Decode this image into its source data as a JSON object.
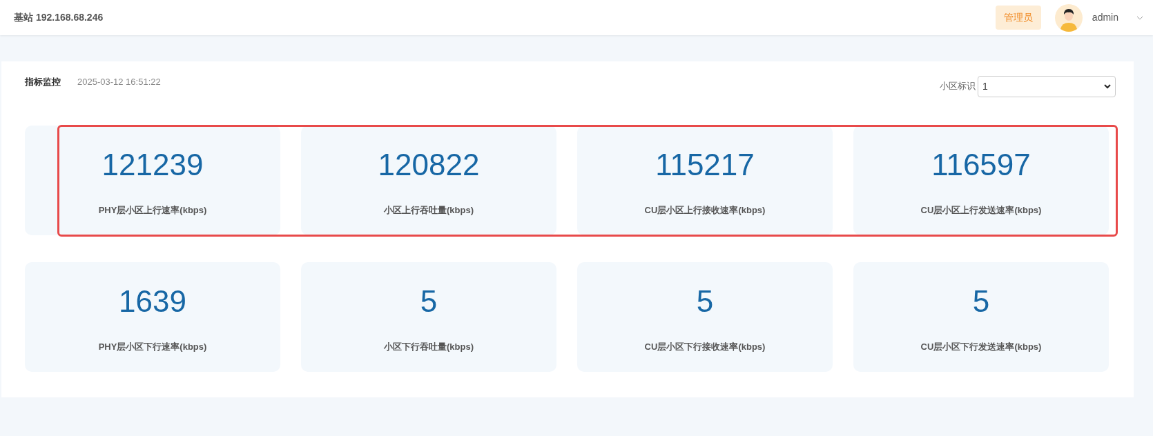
{
  "header": {
    "title": "基站 192.168.68.246",
    "role_badge": "管理员",
    "user": "admin"
  },
  "panel": {
    "title": "指标监控",
    "timestamp": "2025-03-12 16:51:22",
    "cell_select": {
      "label": "小区标识",
      "value": "1"
    },
    "rows": [
      {
        "highlighted": true,
        "metrics": [
          {
            "value": "121239",
            "label": "PHY层小区上行速率(kbps)"
          },
          {
            "value": "120822",
            "label": "小区上行吞吐量(kbps)"
          },
          {
            "value": "115217",
            "label": "CU层小区上行接收速率(kbps)"
          },
          {
            "value": "116597",
            "label": "CU层小区上行发送速率(kbps)"
          }
        ]
      },
      {
        "highlighted": false,
        "metrics": [
          {
            "value": "1639",
            "label": "PHY层小区下行速率(kbps)"
          },
          {
            "value": "5",
            "label": "小区下行吞吐量(kbps)"
          },
          {
            "value": "5",
            "label": "CU层小区下行接收速率(kbps)"
          },
          {
            "value": "5",
            "label": "CU层小区下行发送速率(kbps)"
          }
        ]
      }
    ]
  }
}
